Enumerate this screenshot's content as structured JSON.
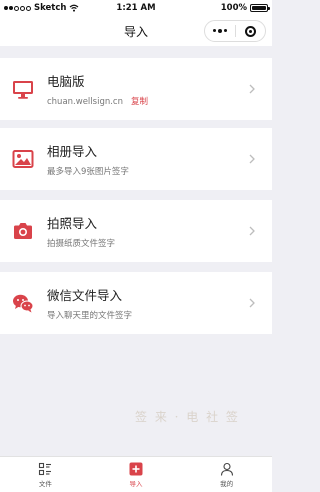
{
  "status_bar": {
    "carrier": "Sketch",
    "time": "1:21 AM",
    "battery": "100%"
  },
  "nav": {
    "title": "导入"
  },
  "items": [
    {
      "title": "电脑版",
      "subtitle": "chuan.wellsign.cn",
      "tag": "复制",
      "icon": "monitor-icon"
    },
    {
      "title": "相册导入",
      "subtitle": "最多导入9张图片签字",
      "icon": "image-icon"
    },
    {
      "title": "拍照导入",
      "subtitle": "拍摄纸质文件签字",
      "icon": "camera-icon"
    },
    {
      "title": "微信文件导入",
      "subtitle": "导入聊天里的文件签字",
      "icon": "wechat-icon"
    }
  ],
  "watermark": "签 来 · 电 社 签",
  "tabbar": {
    "tabs": [
      {
        "label": "文件",
        "icon": "document-list-icon",
        "active": false
      },
      {
        "label": "导入",
        "icon": "plus-square-icon",
        "active": true
      },
      {
        "label": "我的",
        "icon": "person-icon",
        "active": false
      }
    ]
  },
  "colors": {
    "accent": "#d9434a",
    "background": "#efeff4"
  }
}
